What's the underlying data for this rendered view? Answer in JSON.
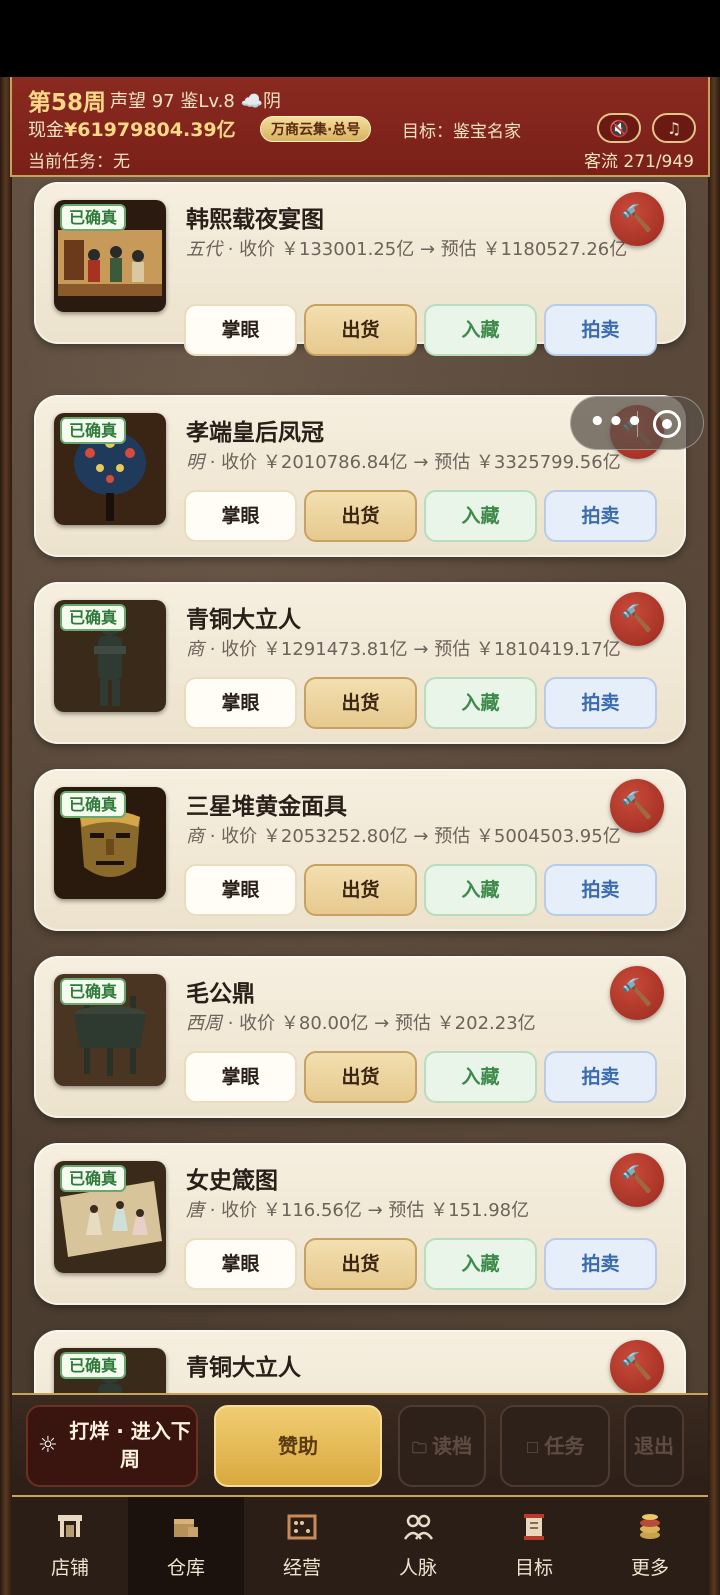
{
  "header": {
    "week": "第58周",
    "stats": "声望 97  鉴Lv.8 ☁️阴",
    "cash_label": "现金",
    "cash_value": "¥61979804.39亿",
    "badge": "万商云集·总号",
    "goal": "目标：鉴宝名家",
    "mute_icon": "🔇",
    "music_icon": "♫",
    "task": "当前任务：无",
    "traffic": "客流 271/949"
  },
  "items": [
    {
      "tag": "已确真",
      "name": "韩熙载夜宴图",
      "era": "五代",
      "desc": " · 收价 ￥133001.25亿 → 预估 ￥1180527.26亿"
    },
    {
      "tag": "已确真",
      "name": "孝端皇后凤冠",
      "era": "明",
      "desc": " · 收价 ￥2010786.84亿 → 预估 ￥3325799.56亿"
    },
    {
      "tag": "已确真",
      "name": "青铜大立人",
      "era": "商",
      "desc": " · 收价 ￥1291473.81亿 → 预估 ￥1810419.17亿"
    },
    {
      "tag": "已确真",
      "name": "三星堆黄金面具",
      "era": "商",
      "desc": " · 收价 ￥2053252.80亿 → 预估 ￥5004503.95亿"
    },
    {
      "tag": "已确真",
      "name": "毛公鼎",
      "era": "西周",
      "desc": " · 收价 ￥80.00亿 → 预估 ￥202.23亿"
    },
    {
      "tag": "已确真",
      "name": "女史箴图",
      "era": "唐",
      "desc": " · 收价 ￥116.56亿 → 预估 ￥151.98亿"
    },
    {
      "tag": "已确真",
      "name": "青铜大立人",
      "era": "",
      "desc": ""
    }
  ],
  "card_buttons": {
    "appraise": "掌眼",
    "ship": "出货",
    "collect": "入藏",
    "auction": "拍卖"
  },
  "capsule": {
    "more": "•••"
  },
  "action_bar": {
    "next_week": "打烊 · 进入下周",
    "sponsor": "赞助",
    "load": "读档",
    "task": "任务",
    "exit": "退出"
  },
  "nav": [
    {
      "label": "店铺",
      "icon": "shop-icon"
    },
    {
      "label": "仓库",
      "icon": "warehouse-icon",
      "active": true
    },
    {
      "label": "经营",
      "icon": "abacus-icon"
    },
    {
      "label": "人脉",
      "icon": "people-icon"
    },
    {
      "label": "目标",
      "icon": "scroll-icon"
    },
    {
      "label": "更多",
      "icon": "coins-icon"
    }
  ]
}
